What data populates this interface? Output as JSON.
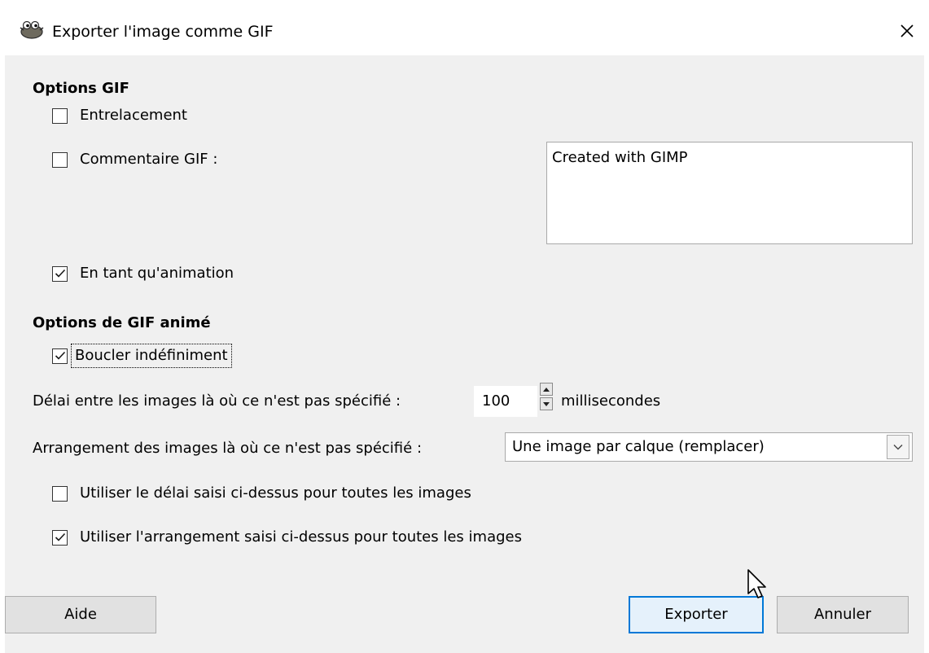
{
  "window": {
    "title": "Exporter l'image comme GIF",
    "icon": "gimp-wilber-icon",
    "close_icon": "close-icon"
  },
  "gif_options": {
    "title": "Options GIF",
    "interlace": {
      "label": "Entrelacement",
      "checked": false
    },
    "comment": {
      "label": "Commentaire GIF :",
      "checked": false,
      "value": "Created with GIMP"
    },
    "as_animation": {
      "label": "En tant qu'animation",
      "checked": true
    }
  },
  "animated_options": {
    "title": "Options de GIF animé",
    "loop_forever": {
      "label": "Boucler indéfiniment",
      "checked": true
    },
    "delay": {
      "label": "Délai entre les images là où ce n'est pas spécifié :",
      "value": "100",
      "unit": "millisecondes"
    },
    "disposal": {
      "label": "Arrangement des images là où ce n'est pas spécifié :",
      "selected": "Une image par calque (remplacer)"
    },
    "use_delay_all": {
      "label": "Utiliser le délai saisi ci-dessus pour toutes les images",
      "checked": false
    },
    "use_disposal_all": {
      "label": "Utiliser l'arrangement saisi ci-dessus pour toutes les images",
      "checked": true
    }
  },
  "buttons": {
    "help": "Aide",
    "export": "Exporter",
    "cancel": "Annuler"
  },
  "colors": {
    "dialog_bg": "#f0f0f0",
    "default_button_border": "#0078d7",
    "default_button_bg": "#e5f1fb"
  }
}
